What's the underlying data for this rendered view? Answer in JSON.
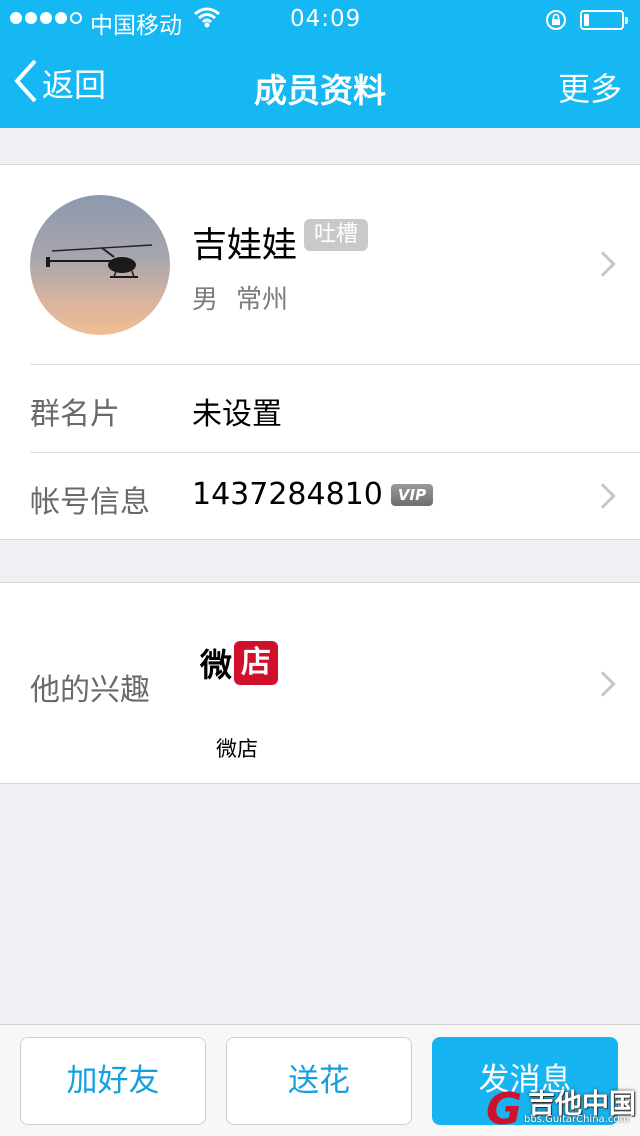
{
  "status": {
    "carrier": "中国移动",
    "time": "04:09",
    "signal_full": 4,
    "battery_level": 0.15
  },
  "nav": {
    "back_label": "返回",
    "title": "成员资料",
    "more_label": "更多"
  },
  "profile": {
    "name": "吉娃娃",
    "badge": "吐槽",
    "gender": "男",
    "city": "常州"
  },
  "rows": {
    "card_label": "群名片",
    "card_value": "未设置",
    "account_label": "帐号信息",
    "account_value": "1437284810",
    "vip_badge": "VIP"
  },
  "interests": {
    "label": "他的兴趣",
    "logo_left": "微",
    "logo_right": "店",
    "app_name": "微店"
  },
  "toolbar": {
    "add_friend": "加好友",
    "send_flower": "送花",
    "send_message": "发消息"
  },
  "watermark": {
    "text": "吉他中国",
    "url": "bbs.GuitarChina.com"
  },
  "colors": {
    "header": "#15b8f2",
    "primary_button": "#16b4f0",
    "accent_text": "#14a0e0",
    "logo_red": "#d0112b"
  }
}
